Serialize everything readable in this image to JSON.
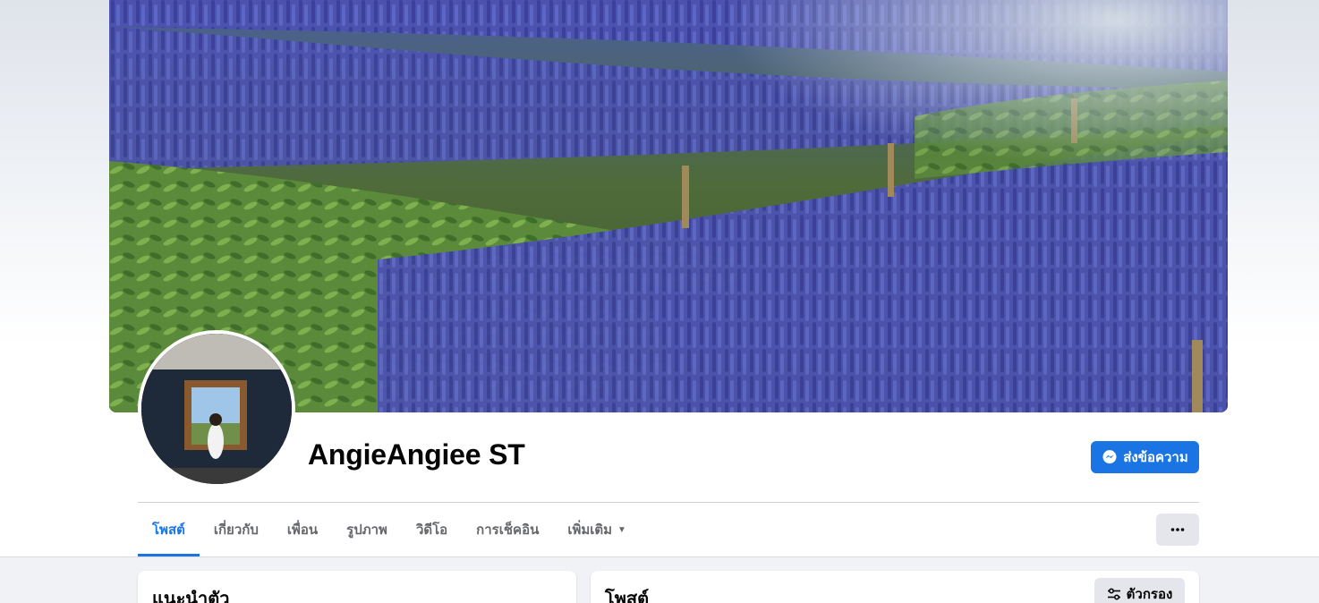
{
  "profile": {
    "name": "AngieAngiee ST"
  },
  "actions": {
    "message_label": "ส่งข้อความ",
    "message_icon": "messenger-icon",
    "more_icon": "more-dots-icon"
  },
  "tabs": [
    {
      "label": "โพสต์",
      "active": true
    },
    {
      "label": "เกี่ยวกับ",
      "active": false
    },
    {
      "label": "เพื่อน",
      "active": false
    },
    {
      "label": "รูปภาพ",
      "active": false
    },
    {
      "label": "วิดีโอ",
      "active": false
    },
    {
      "label": "การเช็คอิน",
      "active": false
    },
    {
      "label": "เพิ่มเติม",
      "active": false,
      "dropdown": true
    }
  ],
  "intro": {
    "title": "แนะนำตัว"
  },
  "posts": {
    "title": "โพสต์",
    "filter_label": "ตัวกรอง",
    "filter_icon": "filter-sliders-icon"
  },
  "colors": {
    "accent": "#1b74e4",
    "tab_inactive": "#65676b",
    "button_gray": "#e4e6eb",
    "page_bg": "#f0f2f5"
  }
}
